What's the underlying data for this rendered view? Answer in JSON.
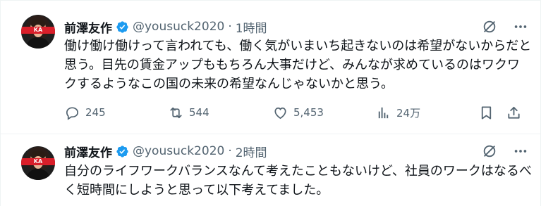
{
  "colors": {
    "text": "#0f1419",
    "muted": "#536471",
    "verified": "#1d9bf0",
    "divider": "#eff3f4",
    "avatar_logo": "#d91f2a"
  },
  "tweets": [
    {
      "name": "前澤友作",
      "handle": "@yousuck2020",
      "dot": "·",
      "time": "1時間",
      "avatar_logo_text": "KA",
      "text": "働け働け働けって言われても、働く気がいまいち起きないのは希望がないからだと思う。目先の賃金アップももちろん大事だけど、みんなが求めているのはワクワクするようなこの国の未来の希望なんじゃないかと思う。",
      "icons": {
        "grok": "slash-circle-icon",
        "more": "more-horizontal-icon"
      },
      "stats": {
        "replies": "245",
        "retweets": "544",
        "likes": "5,453",
        "views": "24万"
      }
    },
    {
      "name": "前澤友作",
      "handle": "@yousuck2020",
      "dot": "·",
      "time": "2時間",
      "avatar_logo_text": "KA",
      "text": "自分のライフワークバランスなんて考えたこともないけど、社員のワークはなるべく短時間にしようと思って以下考えてました。",
      "icons": {
        "grok": "slash-circle-icon",
        "more": "more-horizontal-icon"
      }
    }
  ]
}
